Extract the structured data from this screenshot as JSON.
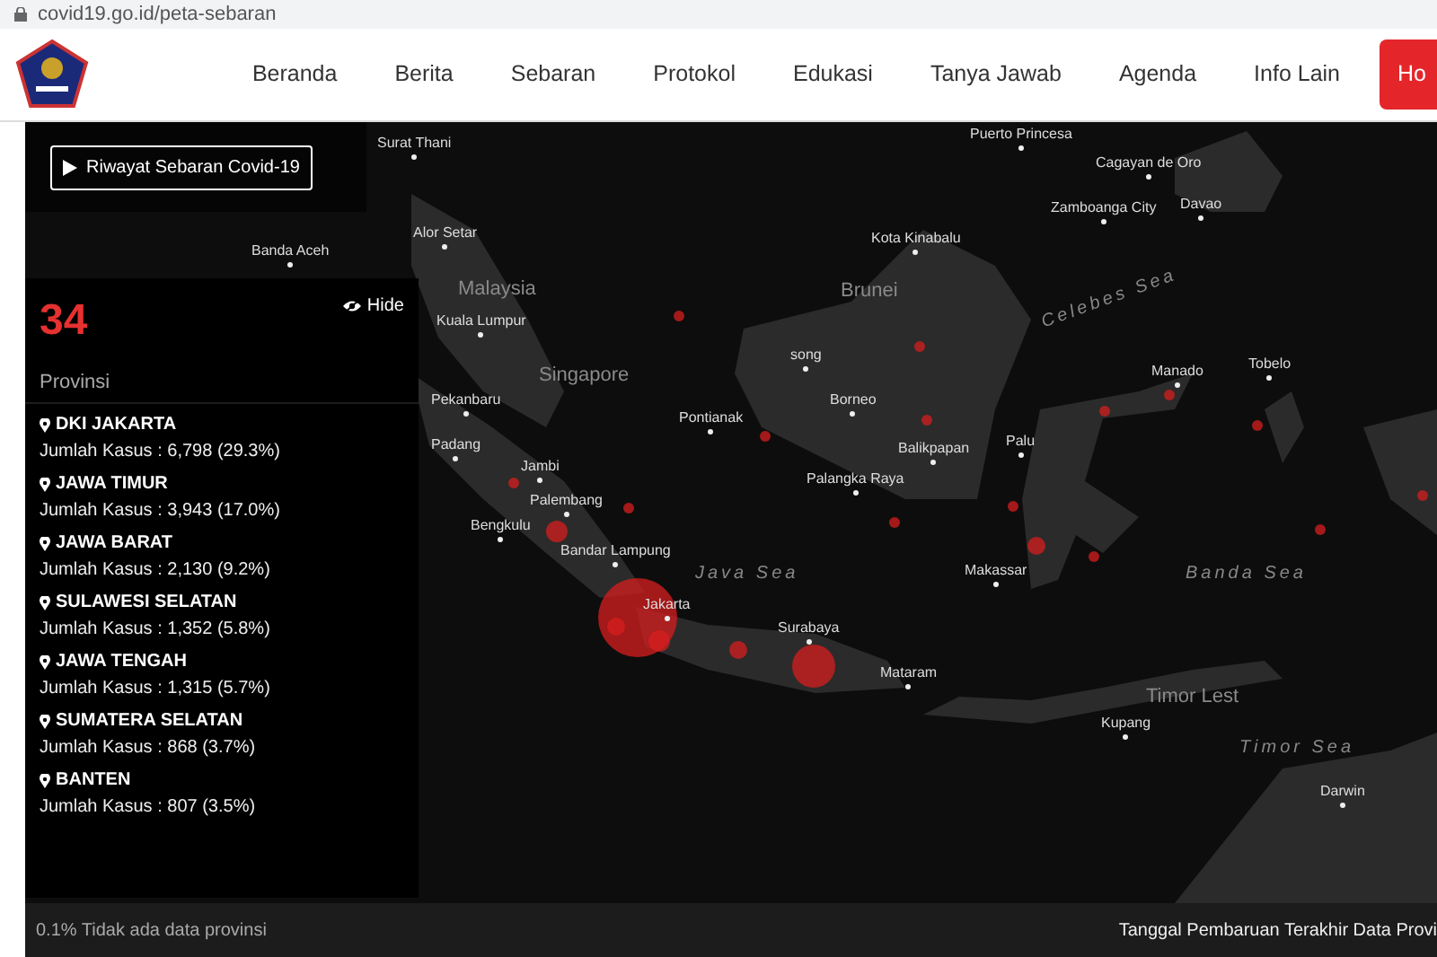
{
  "browser": {
    "url": "covid19.go.id/peta-sebaran"
  },
  "navbar": {
    "items": [
      "Beranda",
      "Berita",
      "Sebaran",
      "Protokol",
      "Edukasi",
      "Tanya Jawab",
      "Agenda",
      "Info Lain"
    ],
    "cta": "Ho"
  },
  "history_button": {
    "label": "Riwayat Sebaran Covid-19"
  },
  "summary": {
    "count": "34",
    "label": "Provinsi",
    "hide_label": "Hide"
  },
  "provinces": [
    {
      "name": "DKI JAKARTA",
      "cases": "Jumlah Kasus : 6,798 (29.3%)"
    },
    {
      "name": "JAWA TIMUR",
      "cases": "Jumlah Kasus : 3,943 (17.0%)"
    },
    {
      "name": "JAWA BARAT",
      "cases": "Jumlah Kasus : 2,130 (9.2%)"
    },
    {
      "name": "SULAWESI SELATAN",
      "cases": "Jumlah Kasus : 1,352 (5.8%)"
    },
    {
      "name": "JAWA TENGAH",
      "cases": "Jumlah Kasus : 1,315 (5.7%)"
    },
    {
      "name": "SUMATERA SELATAN",
      "cases": "Jumlah Kasus : 868 (3.7%)"
    },
    {
      "name": "BANTEN",
      "cases": "Jumlah Kasus : 807 (3.5%)"
    }
  ],
  "map": {
    "labels": [
      {
        "text": "Surat Thani",
        "kind": "city"
      },
      {
        "text": "Alor Setar",
        "kind": "city"
      },
      {
        "text": "Banda Aceh",
        "kind": "city"
      },
      {
        "text": "Malaysia",
        "kind": "country"
      },
      {
        "text": "Kuala Lumpur",
        "kind": "city"
      },
      {
        "text": "Singapore",
        "kind": "country"
      },
      {
        "text": "Pekanbaru",
        "kind": "city"
      },
      {
        "text": "Padang",
        "kind": "city"
      },
      {
        "text": "Jambi",
        "kind": "city"
      },
      {
        "text": "Palembang",
        "kind": "city"
      },
      {
        "text": "Bengkulu",
        "kind": "city"
      },
      {
        "text": "Bandar Lampung",
        "kind": "city"
      },
      {
        "text": "Jakarta",
        "kind": "city"
      },
      {
        "text": "Java Sea",
        "kind": "sea"
      },
      {
        "text": "Surabaya",
        "kind": "city"
      },
      {
        "text": "Mataram",
        "kind": "city"
      },
      {
        "text": "Puerto Princesa",
        "kind": "city"
      },
      {
        "text": "Cagayan de Oro",
        "kind": "city"
      },
      {
        "text": "Zamboanga City",
        "kind": "city"
      },
      {
        "text": "Davao",
        "kind": "city"
      },
      {
        "text": "Kota Kinabalu",
        "kind": "city"
      },
      {
        "text": "Brunei",
        "kind": "country"
      },
      {
        "text": "song",
        "kind": "city"
      },
      {
        "text": "Pontianak",
        "kind": "city"
      },
      {
        "text": "Borneo",
        "kind": "city"
      },
      {
        "text": "Balikpapan",
        "kind": "city"
      },
      {
        "text": "Palangka Raya",
        "kind": "city"
      },
      {
        "text": "Palu",
        "kind": "city"
      },
      {
        "text": "Makassar",
        "kind": "city"
      },
      {
        "text": "Manado",
        "kind": "city"
      },
      {
        "text": "Tobelo",
        "kind": "city"
      },
      {
        "text": "Celebes Sea",
        "kind": "sea"
      },
      {
        "text": "Banda Sea",
        "kind": "sea"
      },
      {
        "text": "Timor Lest",
        "kind": "country"
      },
      {
        "text": "Kupang",
        "kind": "city"
      },
      {
        "text": "Timor Sea",
        "kind": "sea"
      },
      {
        "text": "Darwin",
        "kind": "city"
      }
    ]
  },
  "footer": {
    "note": "0.1% Tidak ada data provinsi",
    "updated": "Tanggal Pembaruan Terakhir Data Provi"
  }
}
